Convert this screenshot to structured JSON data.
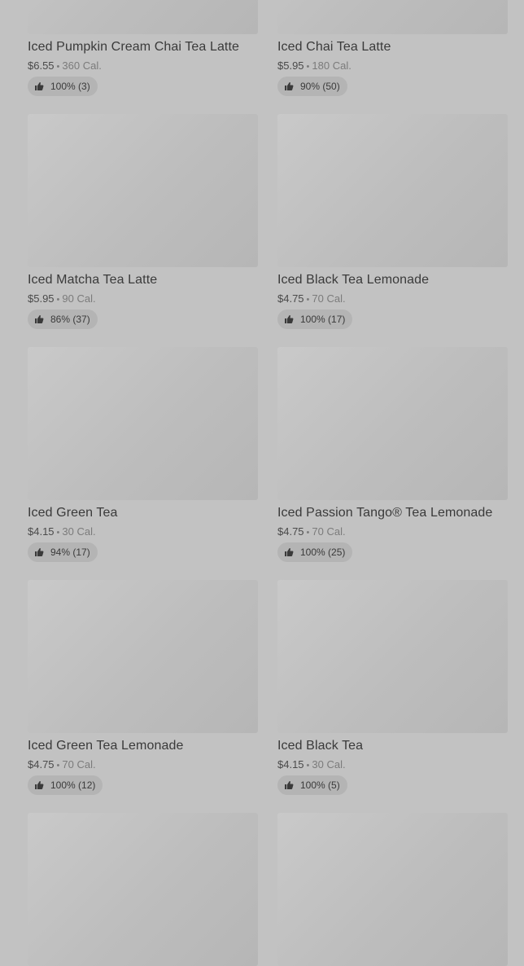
{
  "colors": {
    "backdrop": "#c2c2c2",
    "placeholder": "#bebebe",
    "text": "#3a3a3a"
  },
  "products": [
    {
      "name": "Iced Pumpkin Cream Chai Tea Latte",
      "price": "$6.55",
      "calories": "360 Cal.",
      "rating": "100% (3)",
      "rating_icon": "thumbs-up-icon"
    },
    {
      "name": "Iced Chai Tea Latte",
      "price": "$5.95",
      "calories": "180 Cal.",
      "rating": "90% (50)",
      "rating_icon": "thumbs-up-icon"
    },
    {
      "name": "Iced Matcha Tea Latte",
      "price": "$5.95",
      "calories": "90 Cal.",
      "rating": "86% (37)",
      "rating_icon": "thumbs-up-icon"
    },
    {
      "name": "Iced Black Tea Lemonade",
      "price": "$4.75",
      "calories": "70 Cal.",
      "rating": "100% (17)",
      "rating_icon": "thumbs-up-icon"
    },
    {
      "name": "Iced Green Tea",
      "price": "$4.15",
      "calories": "30 Cal.",
      "rating": "94% (17)",
      "rating_icon": "thumbs-up-icon"
    },
    {
      "name": "Iced Passion Tango® Tea Lemonade",
      "price": "$4.75",
      "calories": "70 Cal.",
      "rating": "100% (25)",
      "rating_icon": "thumbs-up-icon"
    },
    {
      "name": "Iced Green Tea Lemonade",
      "price": "$4.75",
      "calories": "70 Cal.",
      "rating": "100% (12)",
      "rating_icon": "thumbs-up-icon"
    },
    {
      "name": "Iced Black Tea",
      "price": "$4.15",
      "calories": "30 Cal.",
      "rating": "100% (5)",
      "rating_icon": "thumbs-up-icon"
    },
    {
      "name": "",
      "price": "",
      "calories": "",
      "rating": "",
      "rating_icon": ""
    },
    {
      "name": "",
      "price": "",
      "calories": "",
      "rating": "",
      "rating_icon": ""
    }
  ],
  "separator": "•"
}
